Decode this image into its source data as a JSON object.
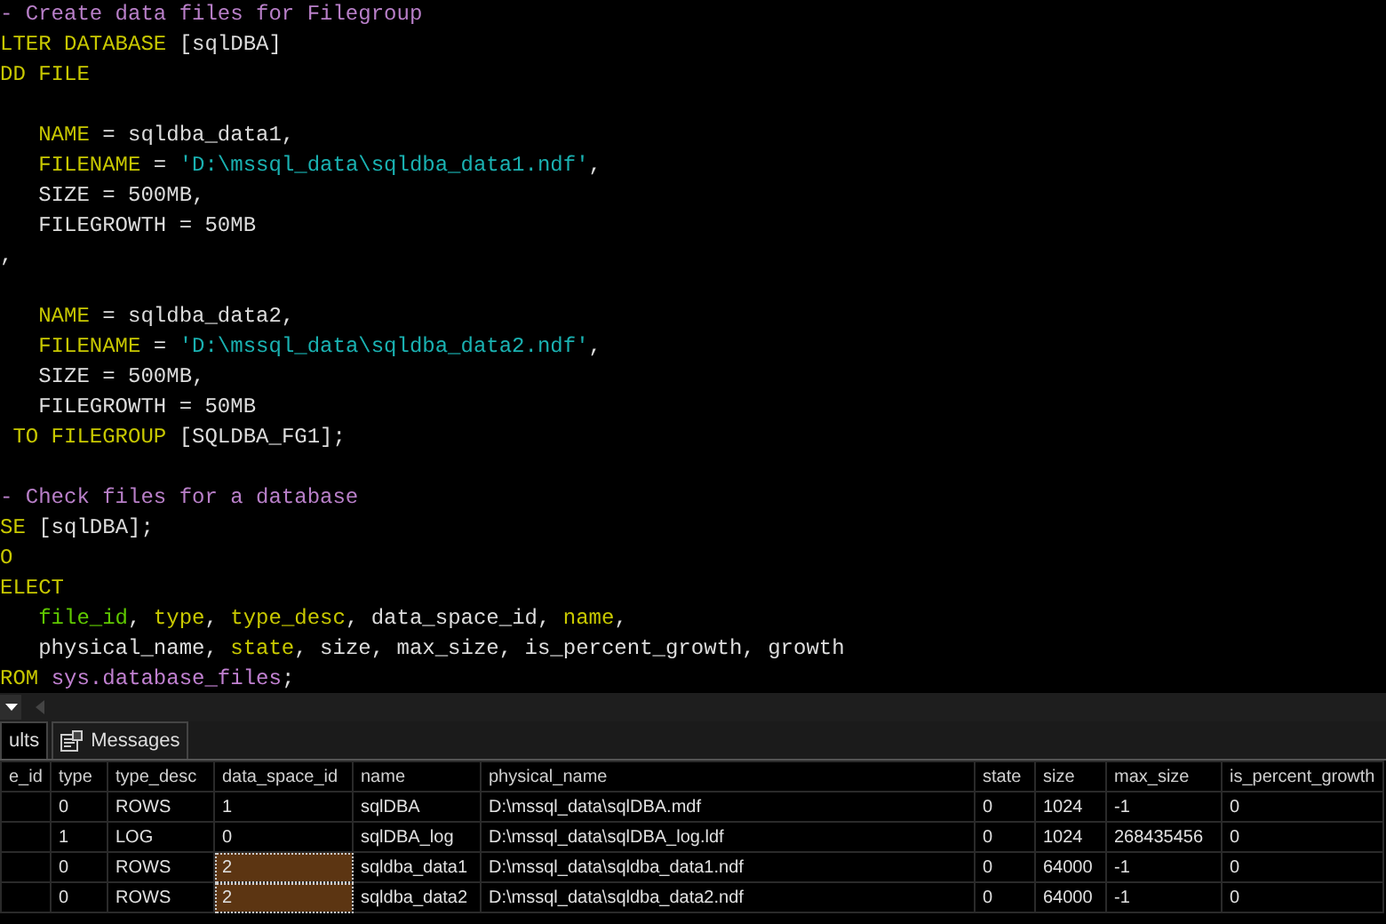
{
  "editor": {
    "lines": [
      {
        "kind": "code",
        "tokens": [
          {
            "kind": "comment",
            "text": "- Create data files for Filegroup"
          }
        ]
      },
      {
        "kind": "code",
        "tokens": [
          {
            "kind": "keyword",
            "text": "LTER DATABASE "
          },
          {
            "kind": "plain",
            "text": "[sqlDBA]"
          }
        ]
      },
      {
        "kind": "code",
        "tokens": [
          {
            "kind": "keyword",
            "text": "DD FILE"
          }
        ]
      },
      {
        "kind": "blank"
      },
      {
        "kind": "code",
        "tokens": [
          {
            "kind": "keyword",
            "text": "   NAME "
          },
          {
            "kind": "plain",
            "text": "= sqldba_data1,"
          }
        ]
      },
      {
        "kind": "code",
        "tokens": [
          {
            "kind": "keyword",
            "text": "   FILENAME "
          },
          {
            "kind": "plain",
            "text": "= "
          },
          {
            "kind": "string",
            "text": "'D:\\mssql_data\\sqldba_data1.ndf'"
          },
          {
            "kind": "plain",
            "text": ","
          }
        ]
      },
      {
        "kind": "code",
        "tokens": [
          {
            "kind": "plain",
            "text": "   SIZE = 500MB,"
          }
        ]
      },
      {
        "kind": "code",
        "tokens": [
          {
            "kind": "plain",
            "text": "   FILEGROWTH = 50MB"
          }
        ]
      },
      {
        "kind": "code",
        "tokens": [
          {
            "kind": "plain",
            "text": ","
          }
        ]
      },
      {
        "kind": "blank"
      },
      {
        "kind": "code",
        "tokens": [
          {
            "kind": "keyword",
            "text": "   NAME "
          },
          {
            "kind": "plain",
            "text": "= sqldba_data2,"
          }
        ]
      },
      {
        "kind": "code",
        "tokens": [
          {
            "kind": "keyword",
            "text": "   FILENAME "
          },
          {
            "kind": "plain",
            "text": "= "
          },
          {
            "kind": "string",
            "text": "'D:\\mssql_data\\sqldba_data2.ndf'"
          },
          {
            "kind": "plain",
            "text": ","
          }
        ]
      },
      {
        "kind": "code",
        "tokens": [
          {
            "kind": "plain",
            "text": "   SIZE = 500MB,"
          }
        ]
      },
      {
        "kind": "code",
        "tokens": [
          {
            "kind": "plain",
            "text": "   FILEGROWTH = 50MB"
          }
        ]
      },
      {
        "kind": "code",
        "tokens": [
          {
            "kind": "keyword",
            "text": " TO FILEGROUP "
          },
          {
            "kind": "plain",
            "text": "[SQLDBA_FG1];"
          }
        ]
      },
      {
        "kind": "blank"
      },
      {
        "kind": "code",
        "tokens": [
          {
            "kind": "comment",
            "text": "- Check files for a database"
          }
        ]
      },
      {
        "kind": "code",
        "tokens": [
          {
            "kind": "keyword",
            "text": "SE "
          },
          {
            "kind": "plain",
            "text": "[sqlDBA];"
          }
        ]
      },
      {
        "kind": "code",
        "tokens": [
          {
            "kind": "keyword",
            "text": "O"
          }
        ]
      },
      {
        "kind": "code",
        "tokens": [
          {
            "kind": "keyword",
            "text": "ELECT"
          }
        ]
      },
      {
        "kind": "code",
        "tokens": [
          {
            "kind": "column",
            "text": "   file_id"
          },
          {
            "kind": "plain",
            "text": ", "
          },
          {
            "kind": "keyword",
            "text": "type"
          },
          {
            "kind": "plain",
            "text": ", "
          },
          {
            "kind": "keyword",
            "text": "type_desc"
          },
          {
            "kind": "plain",
            "text": ", data_space_id, "
          },
          {
            "kind": "keyword",
            "text": "name"
          },
          {
            "kind": "plain",
            "text": ","
          }
        ]
      },
      {
        "kind": "code",
        "tokens": [
          {
            "kind": "plain",
            "text": "   physical_name, "
          },
          {
            "kind": "keyword",
            "text": "state"
          },
          {
            "kind": "plain",
            "text": ", size, max_size, is_percent_growth, growth"
          }
        ]
      },
      {
        "kind": "code",
        "tokens": [
          {
            "kind": "keyword",
            "text": "ROM "
          },
          {
            "kind": "system",
            "text": "sys.database_files"
          },
          {
            "kind": "plain",
            "text": ";"
          }
        ]
      }
    ]
  },
  "result_tabs": [
    {
      "label": "ults",
      "selected": true
    },
    {
      "label": "Messages",
      "selected": false
    }
  ],
  "grid": {
    "columns": [
      "e_id",
      "type",
      "type_desc",
      "data_space_id",
      "name",
      "physical_name",
      "state",
      "size",
      "max_size",
      "is_percent_growth"
    ],
    "rows": [
      {
        "cells": [
          {
            "text": "",
            "selected": false
          },
          {
            "text": "0",
            "selected": false
          },
          {
            "text": "ROWS",
            "selected": false
          },
          {
            "text": "1",
            "selected": false
          },
          {
            "text": "sqlDBA",
            "selected": false
          },
          {
            "text": "D:\\mssql_data\\sqlDBA.mdf",
            "selected": false
          },
          {
            "text": "0",
            "selected": false
          },
          {
            "text": "1024",
            "selected": false
          },
          {
            "text": "-1",
            "selected": false
          },
          {
            "text": "0",
            "selected": false
          }
        ]
      },
      {
        "cells": [
          {
            "text": "",
            "selected": false
          },
          {
            "text": "1",
            "selected": false
          },
          {
            "text": "LOG",
            "selected": false
          },
          {
            "text": "0",
            "selected": false
          },
          {
            "text": "sqlDBA_log",
            "selected": false
          },
          {
            "text": "D:\\mssql_data\\sqlDBA_log.ldf",
            "selected": false
          },
          {
            "text": "0",
            "selected": false
          },
          {
            "text": "1024",
            "selected": false
          },
          {
            "text": "268435456",
            "selected": false
          },
          {
            "text": "0",
            "selected": false
          }
        ]
      },
      {
        "cells": [
          {
            "text": "",
            "selected": false
          },
          {
            "text": "0",
            "selected": false
          },
          {
            "text": "ROWS",
            "selected": false
          },
          {
            "text": "2",
            "selected": true
          },
          {
            "text": "sqldba_data1",
            "selected": false
          },
          {
            "text": "D:\\mssql_data\\sqldba_data1.ndf",
            "selected": false
          },
          {
            "text": "0",
            "selected": false
          },
          {
            "text": "64000",
            "selected": false
          },
          {
            "text": "-1",
            "selected": false
          },
          {
            "text": "0",
            "selected": false
          }
        ]
      },
      {
        "cells": [
          {
            "text": "",
            "selected": false
          },
          {
            "text": "0",
            "selected": false
          },
          {
            "text": "ROWS",
            "selected": false
          },
          {
            "text": "2",
            "selected": true
          },
          {
            "text": "sqldba_data2",
            "selected": false
          },
          {
            "text": "D:\\mssql_data\\sqldba_data2.ndf",
            "selected": false
          },
          {
            "text": "0",
            "selected": false
          },
          {
            "text": "64000",
            "selected": false
          },
          {
            "text": "-1",
            "selected": false
          },
          {
            "text": "0",
            "selected": false
          }
        ]
      }
    ]
  }
}
